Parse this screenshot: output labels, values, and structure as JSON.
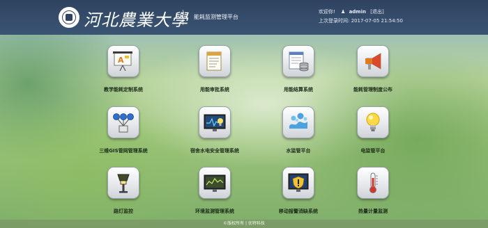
{
  "header": {
    "logo_text": "河北農業大學",
    "platform_name": "能耗监测管理平台",
    "welcome_label": "欢迎你!",
    "username": "admin",
    "logout_label": "[退出]",
    "last_login_label": "上次登录时间:",
    "last_login_time": "2017-07-05 21:54:50"
  },
  "tiles": [
    {
      "label": "教学能耗定制系统",
      "icon": "presentation-icon"
    },
    {
      "label": "用能审批系统",
      "icon": "document-approval-icon"
    },
    {
      "label": "用能结算系统",
      "icon": "settlement-icon"
    },
    {
      "label": "能耗管理制度公布",
      "icon": "megaphone-icon"
    },
    {
      "label": "三维GIS管网管理系统",
      "icon": "network-nodes-icon"
    },
    {
      "label": "宿舍水电安全管理系统",
      "icon": "monitor-bulb-icon"
    },
    {
      "label": "水监管平台",
      "icon": "water-splash-icon"
    },
    {
      "label": "电监管平台",
      "icon": "lightbulb-icon"
    },
    {
      "label": "路灯监控",
      "icon": "street-lamp-icon"
    },
    {
      "label": "环境监测管理系统",
      "icon": "monitor-chart-icon"
    },
    {
      "label": "移动报警消缺系统",
      "icon": "alert-shield-icon"
    },
    {
      "label": "热量计量监测",
      "icon": "thermometer-icon"
    }
  ],
  "footer": {
    "copyright": "©版权所有 | 优特科技"
  },
  "colors": {
    "header_bg": "#2f4360",
    "accent_orange": "#e07a1f",
    "accent_blue": "#2f6fd0"
  }
}
